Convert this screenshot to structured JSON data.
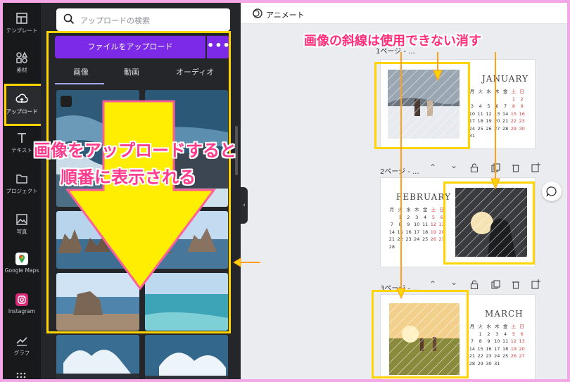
{
  "rail": {
    "items": [
      {
        "label": "テンプレート",
        "icon": "template-icon"
      },
      {
        "label": "素材",
        "icon": "elements-icon"
      },
      {
        "label": "アップロード",
        "icon": "upload-cloud-icon"
      },
      {
        "label": "テキスト",
        "icon": "text-icon"
      },
      {
        "label": "プロジェクト",
        "icon": "folder-icon"
      },
      {
        "label": "写真",
        "icon": "photo-icon"
      },
      {
        "label": "Google Maps",
        "icon": "google-maps-icon"
      },
      {
        "label": "Instagram",
        "icon": "instagram-icon"
      },
      {
        "label": "グラフ",
        "icon": "chart-icon"
      }
    ]
  },
  "panel": {
    "search_placeholder": "アップロードの検索",
    "upload_button": "ファイルをアップロード",
    "more_button": "•••",
    "tabs": [
      "画像",
      "動画",
      "オーディオ"
    ]
  },
  "topbar": {
    "label": "アニメート"
  },
  "pages": [
    {
      "label": "1ページ - ...",
      "month": "JANUARY"
    },
    {
      "label": "2ページ - ...",
      "month": "FEBRUARY"
    },
    {
      "label": "3ページ - ...",
      "month": "MARCH"
    }
  ],
  "calendar": {
    "weekdays": [
      "月",
      "火",
      "水",
      "木",
      "金",
      "土",
      "日"
    ],
    "jan": [
      "1",
      "2",
      "3",
      "4",
      "5",
      "6",
      "7",
      "8",
      "9",
      "10",
      "11",
      "12",
      "13",
      "14",
      "15",
      "16",
      "17",
      "18",
      "19",
      "20",
      "21",
      "22",
      "23",
      "24",
      "25",
      "26",
      "27",
      "28",
      "29",
      "30",
      "31"
    ],
    "feb": [
      "1",
      "2",
      "3",
      "4",
      "5",
      "6",
      "7",
      "8",
      "9",
      "10",
      "11",
      "12",
      "13",
      "14",
      "15",
      "16",
      "17",
      "18",
      "19",
      "20",
      "21",
      "22",
      "23",
      "24",
      "25",
      "26",
      "27",
      "28"
    ],
    "mar": [
      "1",
      "2",
      "3",
      "4",
      "5",
      "6",
      "7",
      "8",
      "9",
      "10",
      "11",
      "12",
      "13",
      "14",
      "15",
      "16",
      "17",
      "18",
      "19",
      "20",
      "21",
      "22",
      "23",
      "24",
      "25",
      "26",
      "27",
      "28",
      "29",
      "30",
      "31"
    ]
  },
  "annotations": {
    "top": "画像の斜線は使用できない消す",
    "mid_line1": "画像をアップロードすると",
    "mid_line2": "順番に表示される"
  },
  "colors": {
    "accent": "#7d2ae8",
    "highlight": "#ffd400",
    "arrow": "#ffee00",
    "annotation_text": "#ff2e7a"
  }
}
